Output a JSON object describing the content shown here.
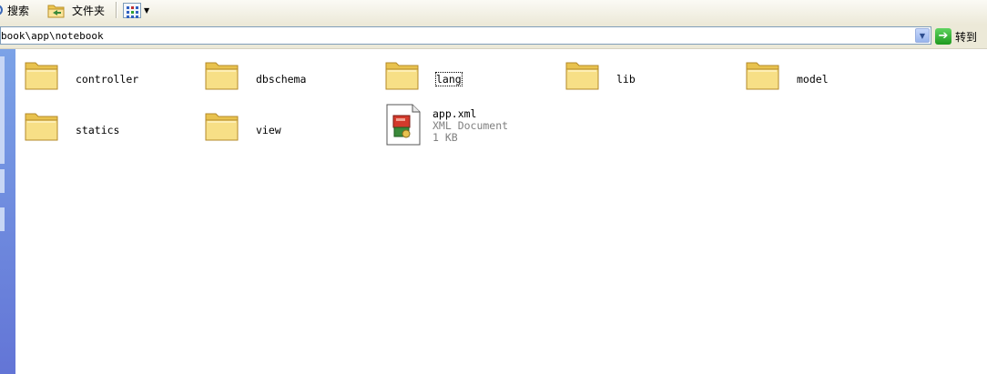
{
  "toolbar": {
    "search_label": "搜索",
    "folders_label": "文件夹",
    "views_icon": "views-icon"
  },
  "address": {
    "path": "book\\app\\notebook",
    "go_label": "转到"
  },
  "colors": {
    "folder_yellow": "#f4d872",
    "taskpane_blue": "#6f8ade",
    "go_green": "#2ea82e"
  },
  "items": [
    {
      "name": "controller",
      "kind": "folder"
    },
    {
      "name": "dbschema",
      "kind": "folder"
    },
    {
      "name": "lang",
      "kind": "folder",
      "focused": true
    },
    {
      "name": "lib",
      "kind": "folder"
    },
    {
      "name": "model",
      "kind": "folder"
    },
    {
      "name": "statics",
      "kind": "folder"
    },
    {
      "name": "view",
      "kind": "folder"
    },
    {
      "name": "app.xml",
      "kind": "file",
      "type": "XML Document",
      "size": "1 KB"
    }
  ]
}
